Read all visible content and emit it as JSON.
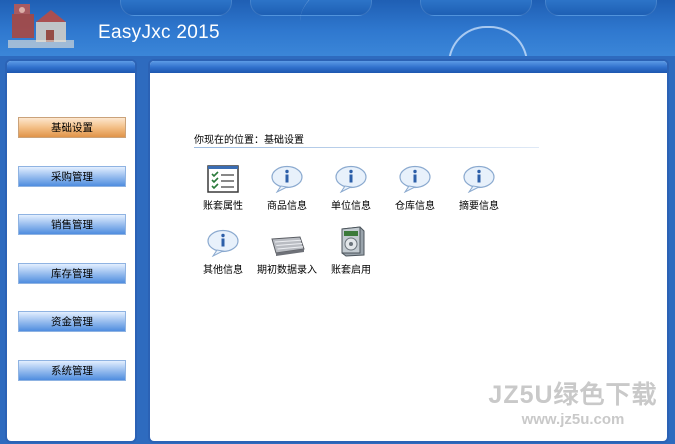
{
  "window": {
    "title": "EasyJxc 2015"
  },
  "sidebar": {
    "items": [
      {
        "label": "基础设置",
        "active": true
      },
      {
        "label": "采购管理",
        "active": false
      },
      {
        "label": "销售管理",
        "active": false
      },
      {
        "label": "库存管理",
        "active": false
      },
      {
        "label": "资金管理",
        "active": false
      },
      {
        "label": "系统管理",
        "active": false
      }
    ]
  },
  "main": {
    "breadcrumb": "你现在的位置：基础设置",
    "items": [
      {
        "label": "账套属性",
        "icon": "checklist-icon"
      },
      {
        "label": "商品信息",
        "icon": "info-icon"
      },
      {
        "label": "单位信息",
        "icon": "info-icon"
      },
      {
        "label": "仓库信息",
        "icon": "info-icon"
      },
      {
        "label": "摘要信息",
        "icon": "info-icon"
      },
      {
        "label": "其他信息",
        "icon": "info-icon"
      },
      {
        "label": "期初数据录入",
        "icon": "keyboard-icon"
      },
      {
        "label": "账套启用",
        "icon": "software-box-icon"
      }
    ]
  },
  "watermark": {
    "line1": "JZ5U绿色下载",
    "line2": "www.jz5u.com"
  },
  "colors": {
    "header": "#2f78cf",
    "active_tab": "#f3bf86",
    "nav_button": "#6fa3e6",
    "panel_border": "#2b62b5"
  }
}
